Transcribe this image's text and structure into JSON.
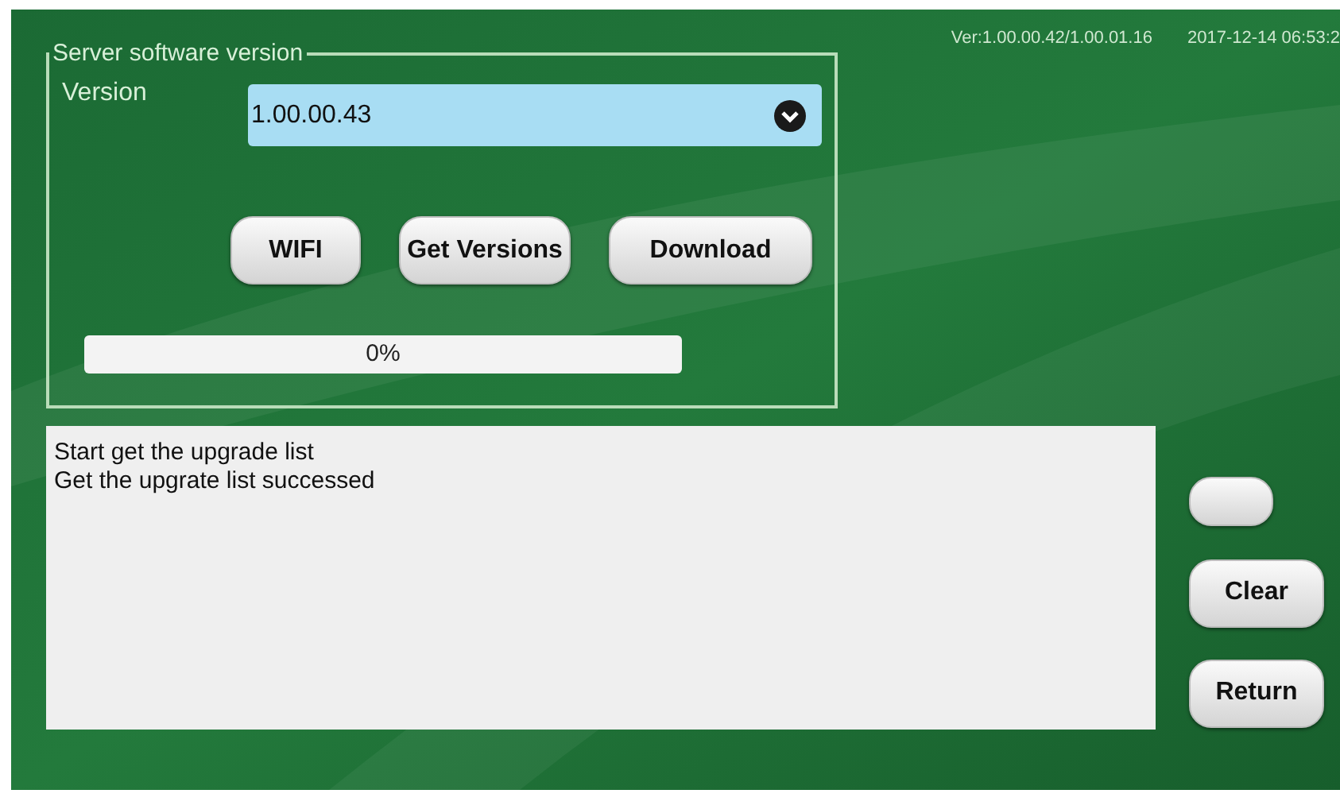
{
  "status_line": {
    "version": "Ver:1.00.00.42/1.00.01.16",
    "datetime": "2017-12-14 06:53:2"
  },
  "server_panel": {
    "legend": "Server software version",
    "version_label": "Version",
    "version_value": "1.00.00.43",
    "buttons": [
      "WIFI",
      "Get Versions",
      "Download"
    ],
    "progress": {
      "level": 0,
      "reading": "0%"
    }
  },
  "log": [
    "Start get the upgrade list",
    "Get the upgrate list successed"
  ],
  "side_buttons": [
    {
      "kind": "blank"
    },
    {
      "kind": "text",
      "label": "Clear"
    },
    {
      "kind": "text",
      "label": "Return"
    }
  ]
}
